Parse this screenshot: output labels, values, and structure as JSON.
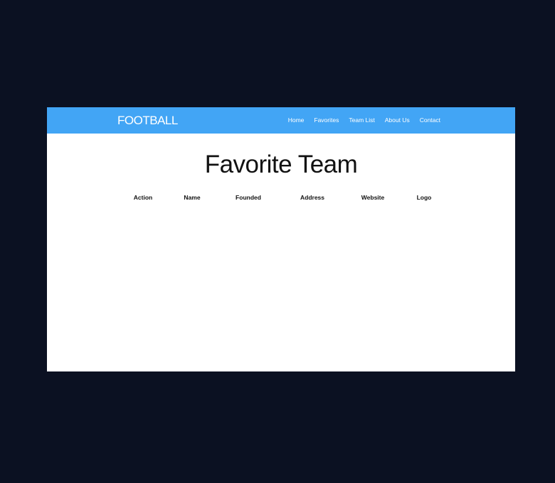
{
  "navbar": {
    "brand": "FOOTBALL",
    "links": [
      "Home",
      "Favorites",
      "Team List",
      "About Us",
      "Contact"
    ]
  },
  "main": {
    "title": "Favorite Team",
    "table": {
      "columns": [
        "Action",
        "Name",
        "Founded",
        "Address",
        "Website",
        "Logo"
      ],
      "rows": []
    }
  },
  "colors": {
    "background": "#0b1122",
    "navbar": "#42a5f5",
    "page": "#ffffff"
  }
}
